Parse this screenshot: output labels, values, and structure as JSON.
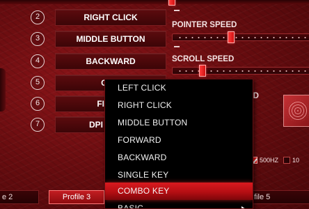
{
  "buttons": [
    {
      "number": "2",
      "label": "RIGHT CLICK"
    },
    {
      "number": "3",
      "label": "MIDDLE BUTTON"
    },
    {
      "number": "4",
      "label": "BACKWARD"
    },
    {
      "number": "5",
      "label": "Ctrl+"
    },
    {
      "number": "6",
      "label": "FIRE K"
    },
    {
      "number": "7",
      "label": "DPI SWITC"
    }
  ],
  "sliders": {
    "pointer_speed": {
      "label": "POINTER SPEED",
      "level": 0.42
    },
    "scroll_speed": {
      "label": "SCROLL SPEED",
      "level": 0.2
    }
  },
  "partial_label": "ED",
  "report_rate": {
    "option_500": "500HZ",
    "option_1000": "10",
    "selected": "500HZ"
  },
  "profiles": [
    {
      "label": "e 2",
      "active": false
    },
    {
      "label": "Profile 3",
      "active": true
    },
    {
      "label": "file 5",
      "active": false
    }
  ],
  "dropdown": {
    "items": [
      "LEFT CLICK",
      "RIGHT CLICK",
      "MIDDLE BUTTON",
      "FORWARD",
      "BACKWARD",
      "SINGLE KEY",
      "COMBO KEY",
      "BASIC"
    ],
    "selected": "COMBO KEY"
  },
  "colors": {
    "accent": "#d91a1f",
    "background": "#6a0d10",
    "menu_bg": "#000000"
  }
}
